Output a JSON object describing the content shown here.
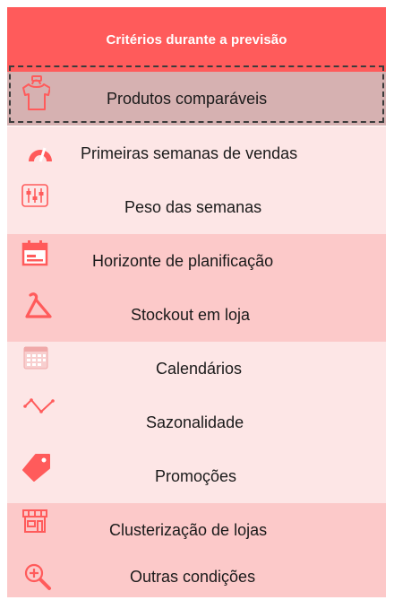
{
  "header": {
    "title": "Critérios durante a previsão"
  },
  "items": [
    {
      "label": "Produtos comparáveis",
      "icon": "tshirt-icon",
      "selected": true
    },
    {
      "label": "Primeiras semanas de vendas",
      "icon": "speedometer-icon"
    },
    {
      "label": "Peso das semanas",
      "icon": "sliders-icon"
    },
    {
      "label": "Horizonte de planificação",
      "icon": "calendar-icon"
    },
    {
      "label": "Stockout em loja",
      "icon": "hanger-icon"
    },
    {
      "label": "Calendários",
      "icon": "calendar-grid-icon"
    },
    {
      "label": "Sazonalidade",
      "icon": "trend-line-icon"
    },
    {
      "label": "Promoções",
      "icon": "price-tag-icon"
    },
    {
      "label": "Clusterização de lojas",
      "icon": "store-icon"
    },
    {
      "label": "Outras condições",
      "icon": "magnifier-plus-icon"
    }
  ],
  "colors": {
    "header": "#ff5b5b",
    "row_light": "#fde6e6",
    "row_dark": "#fcc9c9",
    "selected_row": "#d6b1b1",
    "icon": "#ff5b5b"
  }
}
